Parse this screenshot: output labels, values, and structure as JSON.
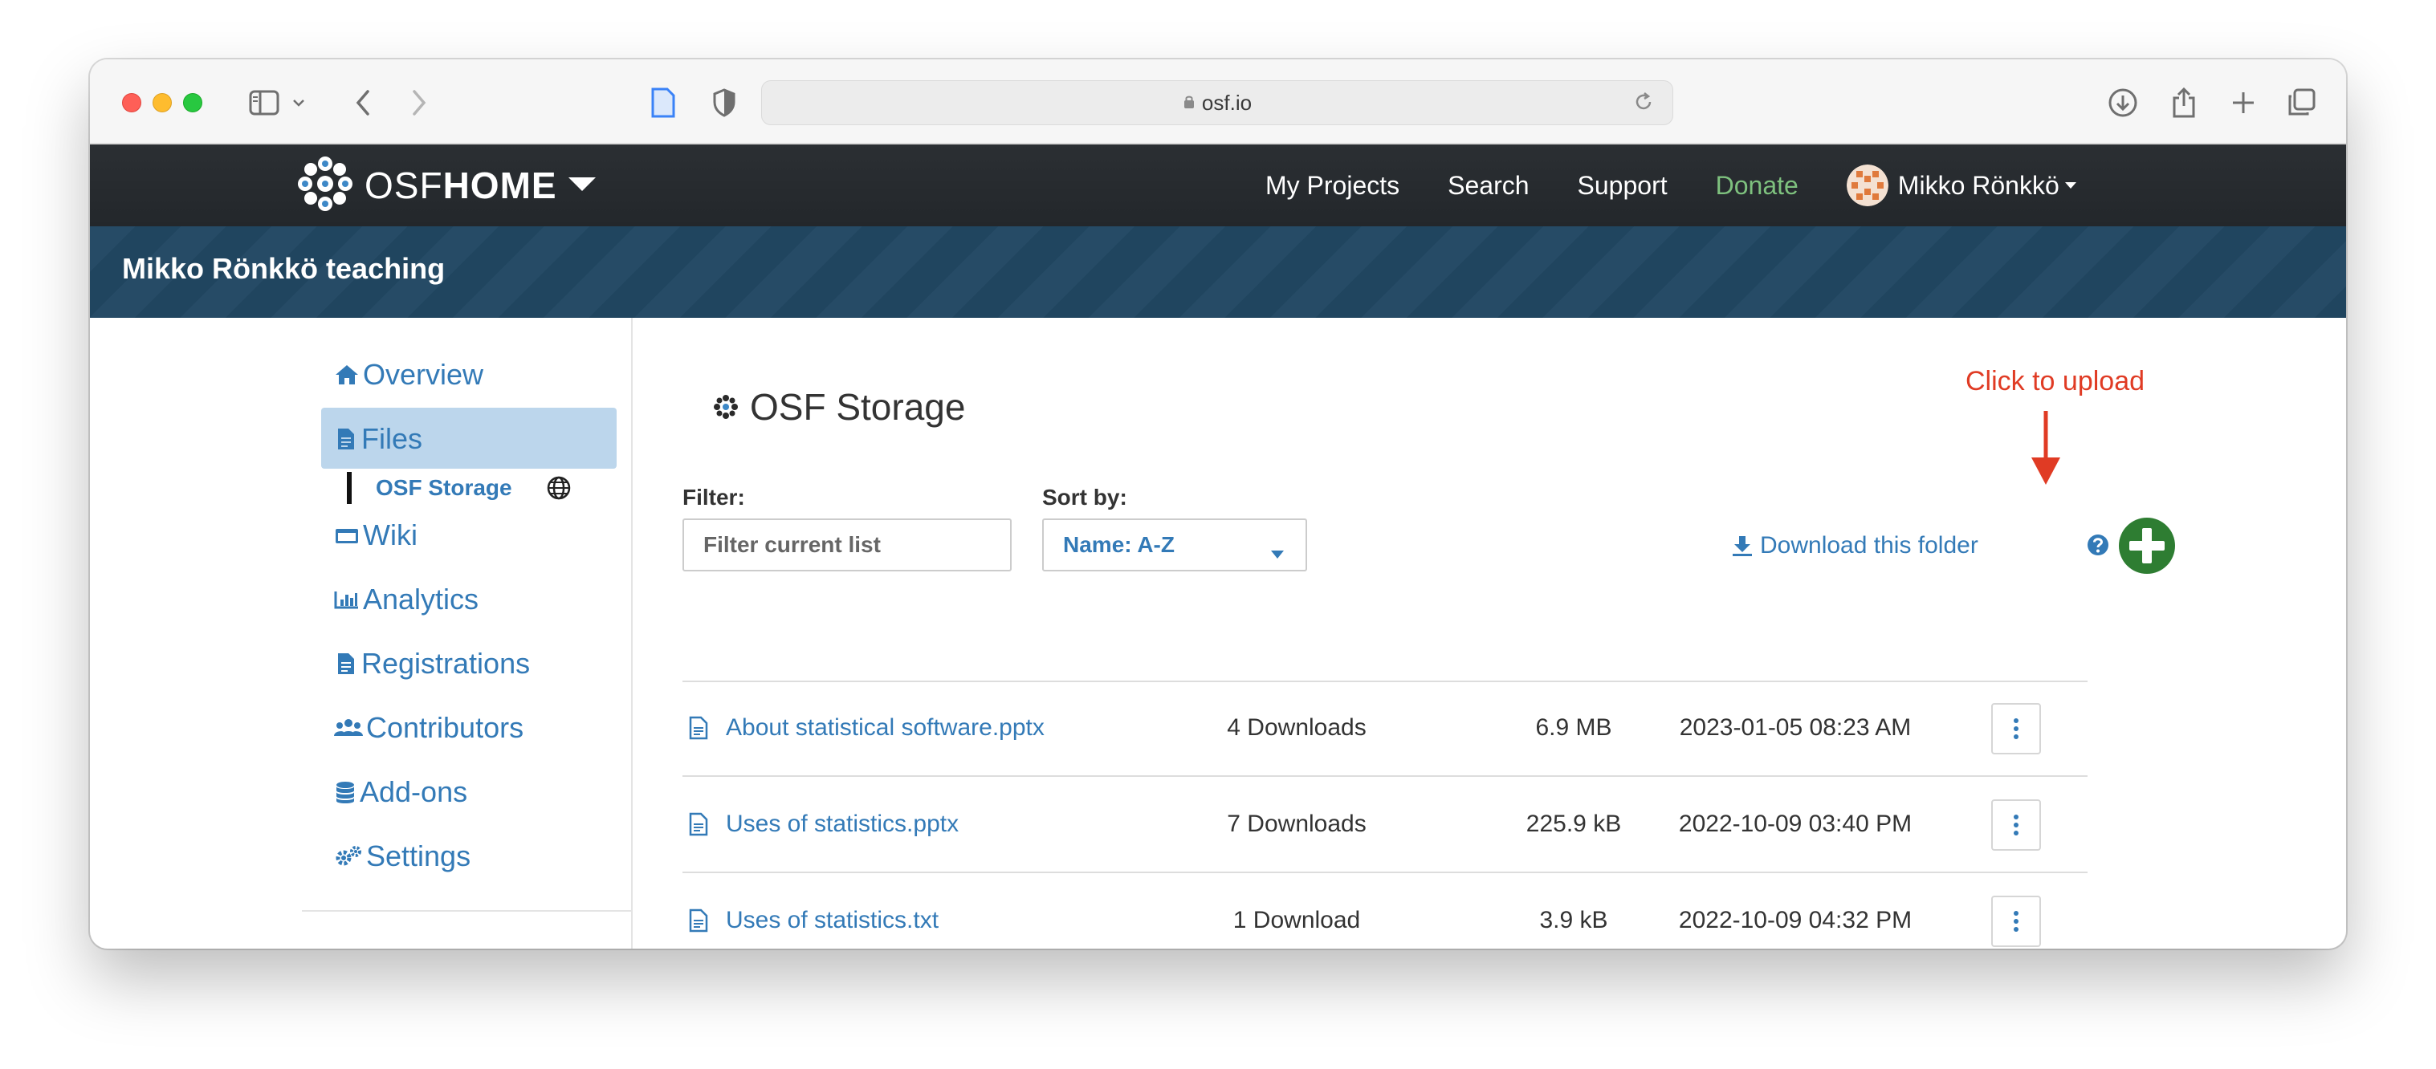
{
  "browser": {
    "url": "osf.io"
  },
  "navbar": {
    "brand_osf": "OSF",
    "brand_home": "HOME",
    "links": {
      "my_projects": "My Projects",
      "search": "Search",
      "support": "Support",
      "donate": "Donate"
    },
    "user_name": "Mikko Rönkkö",
    "colors": {
      "donate": "#7ec17e"
    }
  },
  "project": {
    "title": "Mikko Rönkkö teaching"
  },
  "sidebar": {
    "items": [
      {
        "label": "Overview",
        "icon": "home-icon"
      },
      {
        "label": "Files",
        "icon": "file-icon",
        "active": true
      },
      {
        "label": "Wiki",
        "icon": "wiki-icon"
      },
      {
        "label": "Analytics",
        "icon": "chart-icon"
      },
      {
        "label": "Registrations",
        "icon": "registration-icon"
      },
      {
        "label": "Contributors",
        "icon": "users-icon"
      },
      {
        "label": "Add-ons",
        "icon": "database-icon"
      },
      {
        "label": "Settings",
        "icon": "gears-icon"
      }
    ],
    "sub_item": "OSF Storage"
  },
  "main": {
    "storage_title": "OSF Storage",
    "annotation": "Click to upload",
    "filter_label": "Filter:",
    "filter_placeholder": "Filter current list",
    "sort_label": "Sort by:",
    "sort_value": "Name: A-Z",
    "download_folder": "Download this folder",
    "files": [
      {
        "name": "About statistical software.pptx",
        "downloads": "4 Downloads",
        "size": "6.9 MB",
        "modified": "2023-01-05 08:23 AM"
      },
      {
        "name": "Uses of statistics.pptx",
        "downloads": "7 Downloads",
        "size": "225.9 kB",
        "modified": "2022-10-09 03:40 PM"
      },
      {
        "name": "Uses of statistics.txt",
        "downloads": "1 Download",
        "size": "3.9 kB",
        "modified": "2022-10-09 04:32 PM"
      }
    ],
    "colors": {
      "link": "#337ab7",
      "upload": "#2e7d32",
      "annotation": "#e03b24"
    }
  }
}
